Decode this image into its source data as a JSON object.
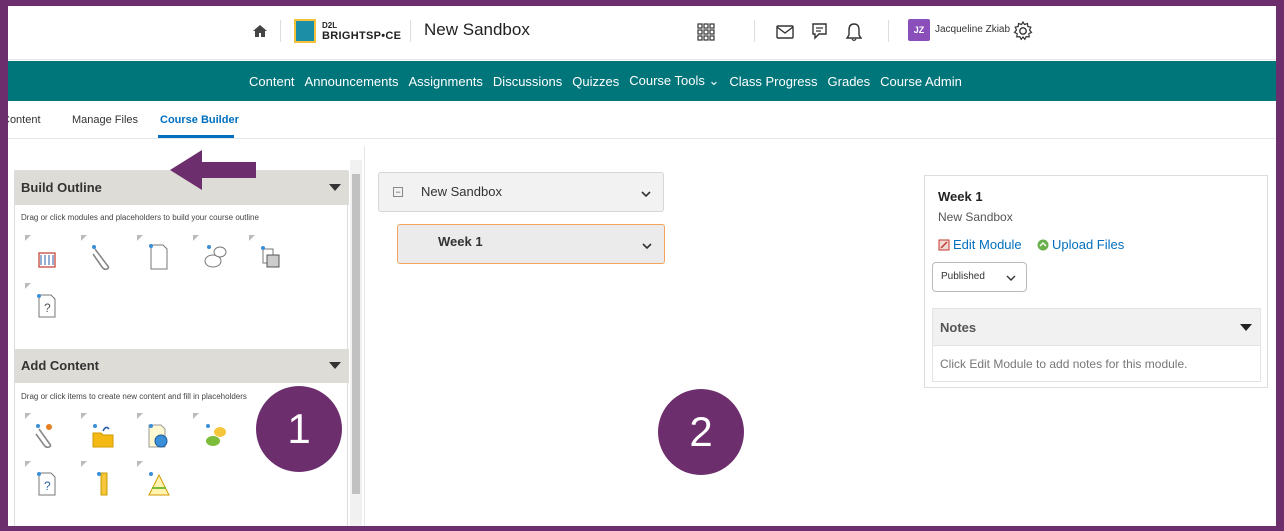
{
  "header": {
    "brand_small": "D2L",
    "brand": "BRIGHTSP•CE",
    "course_title": "New Sandbox",
    "user_initials": "JZ",
    "user_name": "Jacqueline Zkiab"
  },
  "nav": {
    "items": [
      "Content",
      "Announcements",
      "Assignments",
      "Discussions",
      "Quizzes",
      "Course Tools ⌄",
      "Class Progress",
      "Grades",
      "Course Admin"
    ]
  },
  "subtabs": {
    "items": [
      "Content",
      "Manage Files",
      "Course Builder"
    ],
    "active": "Course Builder"
  },
  "left_panel": {
    "build_outline": {
      "title": "Build Outline",
      "desc": "Drag or click modules and placeholders to build your course outline"
    },
    "add_content": {
      "title": "Add Content",
      "desc": "Drag or click items to create new content and fill in placeholders"
    }
  },
  "badges": {
    "one": "1",
    "two": "2"
  },
  "middle": {
    "module_title": "New Sandbox",
    "week_title": "Week 1"
  },
  "right_panel": {
    "title": "Week 1",
    "subtitle": "New Sandbox",
    "edit_module": "Edit Module",
    "upload_files": "Upload Files",
    "status_dropdown": "Published",
    "notes_title": "Notes",
    "notes_text": "Click Edit Module to add notes for this module."
  },
  "colors": {
    "nav_teal": "#00757a",
    "frame_purple": "#6d2e6d",
    "link_blue": "#006fbf",
    "avatar_purple": "#8a4fba"
  }
}
